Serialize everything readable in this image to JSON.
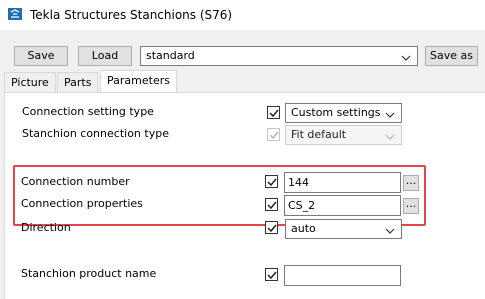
{
  "window": {
    "title": "Tekla Structures  Stanchions (S76)"
  },
  "toolbar": {
    "save_label": "Save",
    "load_label": "Load",
    "preset_value": "standard",
    "save_as_label": "Save as"
  },
  "tabs": [
    {
      "label": "Picture"
    },
    {
      "label": "Parts"
    },
    {
      "label": "Parameters",
      "active": true
    }
  ],
  "params": {
    "connection_setting_type": {
      "label": "Connection setting type",
      "checked": true,
      "value": "Custom settings"
    },
    "stanchion_connection_type": {
      "label": "Stanchion connection type",
      "checked": true,
      "disabled": true,
      "value": "Fit default"
    },
    "connection_number": {
      "label": "Connection number",
      "checked": true,
      "value": "144",
      "browse_label": "..."
    },
    "connection_properties": {
      "label": "Connection properties",
      "checked": true,
      "value": "CS_2",
      "browse_label": "..."
    },
    "direction": {
      "label": "Direction",
      "checked": true,
      "value": "auto"
    },
    "stanchion_product_name": {
      "label": "Stanchion product name",
      "checked": true,
      "value": ""
    }
  },
  "colors": {
    "highlight": "#e0464a",
    "app_icon": "#1f6fb5"
  },
  "icons": [
    "tekla-app-icon",
    "chevron-down-icon",
    "checkmark-icon"
  ]
}
